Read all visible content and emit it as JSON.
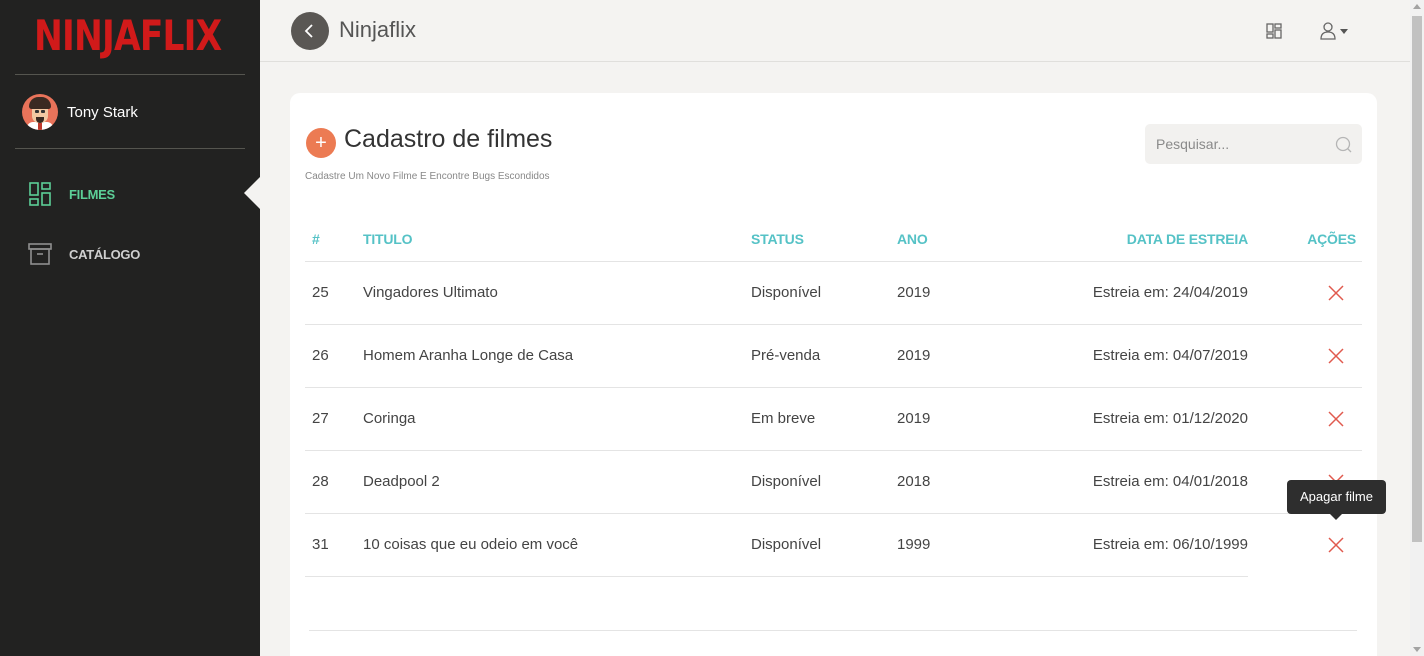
{
  "brand": {
    "logo_text": "NINJAFLIX",
    "logo_color": "#d11a1a"
  },
  "user": {
    "name": "Tony Stark"
  },
  "sidebar": {
    "items": [
      {
        "label": "FILMES",
        "icon": "dashboard-icon",
        "active": true,
        "color": "#5ccf97"
      },
      {
        "label": "CATÁLOGO",
        "icon": "archive-box-icon",
        "active": false
      }
    ]
  },
  "topbar": {
    "title": "Ninjaflix",
    "icons": [
      "back-arrow-icon",
      "grid-layout-icon",
      "user-icon"
    ]
  },
  "page": {
    "title": "Cadastro de filmes",
    "subtitle": "Cadastre Um Novo Filme E Encontre Bugs Escondidos",
    "add_button": "+",
    "accent": "#ec7b53"
  },
  "search": {
    "placeholder": "Pesquisar...",
    "value": ""
  },
  "table": {
    "headers": {
      "id": "#",
      "title": "TITULO",
      "status": "STATUS",
      "year": "ANO",
      "date": "DATA DE ESTREIA",
      "actions": "AÇÕES"
    },
    "header_color": "#55c2c6",
    "rows": [
      {
        "id": "25",
        "title": "Vingadores Ultimato",
        "status": "Disponível",
        "year": "2019",
        "date": "Estreia em: 24/04/2019"
      },
      {
        "id": "26",
        "title": "Homem Aranha Longe de Casa",
        "status": "Pré-venda",
        "year": "2019",
        "date": "Estreia em: 04/07/2019"
      },
      {
        "id": "27",
        "title": "Coringa",
        "status": "Em breve",
        "year": "2019",
        "date": "Estreia em: 01/12/2020"
      },
      {
        "id": "28",
        "title": "Deadpool 2",
        "status": "Disponível",
        "year": "2018",
        "date": "Estreia em: 04/01/2018"
      },
      {
        "id": "31",
        "title": "10 coisas que eu odeio em você",
        "status": "Disponível",
        "year": "1999",
        "date": "Estreia em: 06/10/1999"
      }
    ],
    "delete_icon_color": "#e05a4e"
  },
  "tooltip": {
    "text": "Apagar filme"
  }
}
